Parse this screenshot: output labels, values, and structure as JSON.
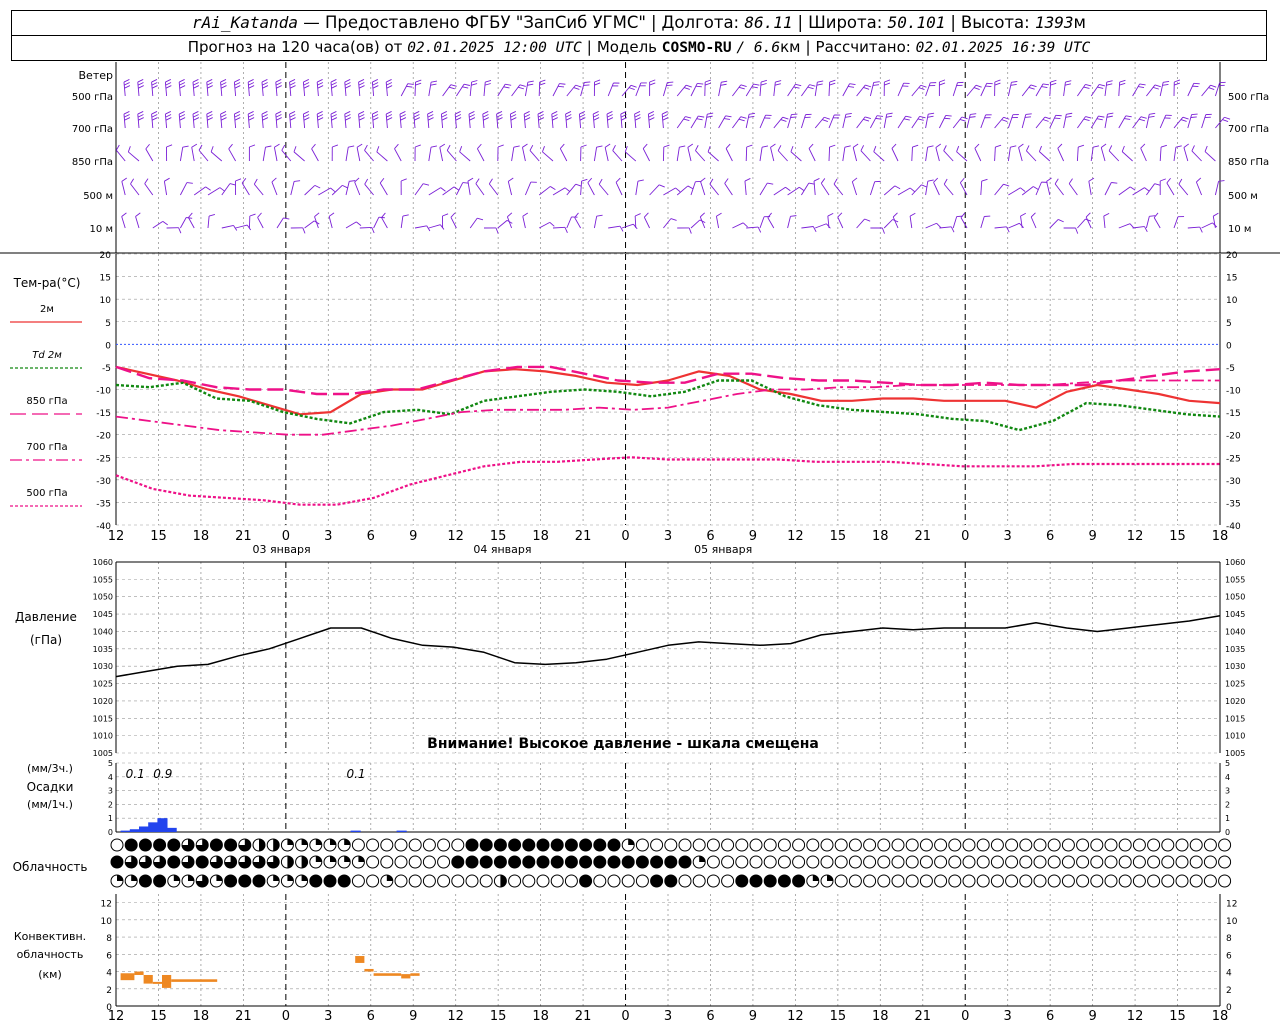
{
  "header": {
    "station": "rAi_Katanda",
    "provided_by": "— Предоставлено ФГБУ \"ЗапСиб УГМС\"",
    "lon_label": "Долгота:",
    "lon_value": "86.11",
    "lat_label": "Широта:",
    "lat_value": "50.101",
    "alt_label": "Высота:",
    "alt_value": "1393",
    "alt_unit": "м",
    "forecast_label": "Прогноз на 120 часа(ов) от",
    "forecast_time": "02.01.2025 12:00 UTC",
    "model_label": "Модель",
    "model_name": "COSMO-RU",
    "model_res": "/ 6.6",
    "model_res_unit": "км",
    "calc_label": "Рассчитано:",
    "calc_time": "02.01.2025 16:39 UTC"
  },
  "colors": {
    "wind": "#7a1fd6",
    "t2m": "#ee3333",
    "td2m": "#118811",
    "magenta": "#ee1188",
    "pressure": "#000000",
    "precip": "#2244ee",
    "conv": "#ee8822",
    "zero_line": "#3355ff",
    "grid": "#999999"
  },
  "chart_data": [
    {
      "type": "wind-barbs",
      "section": "wind",
      "title": "Ветер",
      "levels": [
        "500 гПа",
        "700 гПа",
        "850 гПа",
        "500 м",
        "10   м"
      ]
    },
    {
      "type": "line",
      "section": "temperature",
      "ylabel": "Тем-ра(°C)",
      "ylim": [
        -40,
        20
      ],
      "yticks": [
        20,
        15,
        10,
        5,
        0,
        -5,
        -10,
        -15,
        -20,
        -25,
        -30,
        -35,
        -40
      ],
      "legend": [
        "2м",
        "Td  2м",
        "850 гПа",
        "700 гПа",
        "500 гПа"
      ],
      "x_hours": [
        0,
        3,
        6,
        9,
        12,
        15,
        18,
        21,
        24,
        27,
        30,
        33,
        36,
        39,
        42,
        45,
        48,
        51,
        54,
        57,
        60,
        63,
        66,
        69,
        72,
        75,
        78,
        81,
        84,
        87,
        90,
        93,
        96,
        99,
        102,
        105,
        108,
        111,
        114,
        117,
        120
      ],
      "series": [
        {
          "name": "2м",
          "values": [
            -5,
            -6.5,
            -8,
            -10,
            -11.5,
            -13.5,
            -15.5,
            -15,
            -11,
            -10,
            -10,
            -8,
            -6,
            -5.5,
            -6,
            -7,
            -8.5,
            -9,
            -8,
            -6,
            -7,
            -10,
            -11,
            -12.5,
            -12.5,
            -12,
            -12,
            -12.5,
            -12.5,
            -12.5,
            -14,
            -10.5,
            -9,
            -10,
            -11,
            -12.5,
            -13
          ]
        },
        {
          "name": "Td  2м",
          "values": [
            -9,
            -9.5,
            -8.5,
            -12,
            -12.5,
            -15,
            -16.5,
            -17.5,
            -15,
            -14.5,
            -15.5,
            -12.5,
            -11.5,
            -10.5,
            -10,
            -10.5,
            -11.5,
            -10.5,
            -8,
            -8,
            -11.5,
            -13.5,
            -14.5,
            -15,
            -15.5,
            -16.5,
            -17,
            -19,
            -17,
            -13,
            -13.5,
            -14.5,
            -15.5,
            -16
          ]
        },
        {
          "name": "850 гПа",
          "values": [
            -5,
            -7.5,
            -8,
            -9.5,
            -10,
            -10,
            -11,
            -11,
            -10,
            -10,
            -8,
            -6,
            -5,
            -5,
            -6.5,
            -8,
            -8.5,
            -8.5,
            -6.5,
            -6.5,
            -7.5,
            -8,
            -8,
            -8.5,
            -9,
            -9,
            -8.5,
            -9,
            -9,
            -9,
            -8,
            -7,
            -6,
            -5.5
          ]
        },
        {
          "name": "700 гПа",
          "values": [
            -16,
            -17,
            -18,
            -19,
            -19.5,
            -20,
            -20,
            -19,
            -18,
            -16.5,
            -15,
            -14.5,
            -14.5,
            -14.5,
            -14,
            -14.5,
            -14,
            -12.5,
            -11,
            -10,
            -10,
            -9.5,
            -9.5,
            -9,
            -9,
            -9,
            -9,
            -9,
            -8.5,
            -8,
            -8,
            -8,
            -8
          ]
        },
        {
          "name": "500 гПа",
          "values": [
            -29,
            -32,
            -33.5,
            -34,
            -34.5,
            -35.5,
            -35.5,
            -34,
            -31,
            -29,
            -27,
            -26,
            -26,
            -25.5,
            -25,
            -25.5,
            -25.5,
            -25.5,
            -25.5,
            -26,
            -26,
            -26,
            -26.5,
            -27,
            -27,
            -27,
            -26.5,
            -26.5,
            -26.5,
            -26.5,
            -26.5
          ]
        }
      ]
    },
    {
      "type": "line",
      "section": "pressure",
      "ylabel": "Давление",
      "ylabel2": "(гПа)",
      "ylim": [
        1005,
        1060
      ],
      "yticks": [
        1060,
        1055,
        1050,
        1045,
        1040,
        1035,
        1030,
        1025,
        1020,
        1015,
        1010,
        1005
      ],
      "warning": "Внимание! Высокое давление - шкала смещена",
      "series": [
        {
          "name": "Давление",
          "values": [
            1027,
            1028.5,
            1030,
            1030.5,
            1033,
            1035,
            1038,
            1041,
            1041,
            1038,
            1036,
            1035.5,
            1034,
            1031,
            1030.5,
            1031,
            1032,
            1034,
            1036,
            1037,
            1036.5,
            1036,
            1036.5,
            1039,
            1040,
            1041,
            1040.5,
            1041,
            1041,
            1041,
            1042.5,
            1041,
            1040,
            1041,
            1042,
            1043,
            1044.5
          ]
        }
      ]
    },
    {
      "type": "bar",
      "section": "precipitation",
      "ylabel": "Осадки",
      "unit_top": "(мм/3ч.)",
      "unit_bottom": "(мм/1ч.)",
      "ylim": [
        0,
        5
      ],
      "yticks": [
        5,
        4,
        3,
        2,
        1,
        0
      ],
      "totals": [
        {
          "hour": 1,
          "label": "0.1"
        },
        {
          "hour": 4,
          "label": "0.9"
        },
        {
          "hour": 25,
          "label": "0.1"
        }
      ],
      "hourly_bars": [
        {
          "hour": 1,
          "value": 0.1
        },
        {
          "hour": 2,
          "value": 0.2
        },
        {
          "hour": 3,
          "value": 0.4
        },
        {
          "hour": 4,
          "value": 0.7
        },
        {
          "hour": 5,
          "value": 1.0
        },
        {
          "hour": 6,
          "value": 0.3
        },
        {
          "hour": 26,
          "value": 0.1
        },
        {
          "hour": 31,
          "value": 0.1
        }
      ]
    },
    {
      "type": "cloud-cover",
      "section": "cloudiness",
      "ylabel": "Облачность",
      "rows": [
        "0888866886442222200000000888888888882000000000000000000000000000000000000000000000",
        "8666868666664422220000008888888888888888820000000000000000000000000000000000000000",
        "2288226288822288800200000004000008000088000088888220000000000000000000000000000000"
      ]
    },
    {
      "type": "bar",
      "section": "convective",
      "ylabel": "Конвективн.",
      "ylabel2": "облачность",
      "ylabel3": "(км)",
      "ylim": [
        0,
        13
      ],
      "yticks": [
        12,
        10,
        8,
        6,
        4,
        2,
        0
      ],
      "layers": [
        {
          "from": 0.5,
          "to": 2,
          "bottom": 3.0,
          "top": 3.8
        },
        {
          "from": 2,
          "to": 3,
          "bottom": 3.6,
          "top": 4.0
        },
        {
          "from": 3,
          "to": 4,
          "bottom": 2.6,
          "top": 3.6
        },
        {
          "from": 4,
          "to": 5,
          "bottom": 2.6,
          "top": 2.8
        },
        {
          "from": 5,
          "to": 6,
          "bottom": 2.1,
          "top": 3.6
        },
        {
          "from": 6,
          "to": 11,
          "bottom": 2.8,
          "top": 3.1
        },
        {
          "from": 26,
          "to": 27,
          "bottom": 5.0,
          "top": 5.8
        },
        {
          "from": 27,
          "to": 28,
          "bottom": 4.0,
          "top": 4.3
        },
        {
          "from": 28,
          "to": 31,
          "bottom": 3.5,
          "top": 3.8
        },
        {
          "from": 31,
          "to": 32,
          "bottom": 3.2,
          "top": 3.7
        },
        {
          "from": 32,
          "to": 33,
          "bottom": 3.5,
          "top": 3.8
        }
      ]
    }
  ],
  "x_axis": {
    "tick_labels": [
      "12",
      "15",
      "18",
      "21",
      "0",
      "3",
      "6",
      "9",
      "12",
      "15",
      "18",
      "21",
      "0",
      "3",
      "6",
      "9",
      "12",
      "15",
      "18",
      "21",
      "0",
      "3",
      "6",
      "9",
      "12",
      "15",
      "18"
    ],
    "day_labels": [
      {
        "hour": 18,
        "label": "03 января"
      },
      {
        "hour": 42,
        "label": "04 января"
      },
      {
        "hour": 66,
        "label": "05 января"
      }
    ]
  }
}
